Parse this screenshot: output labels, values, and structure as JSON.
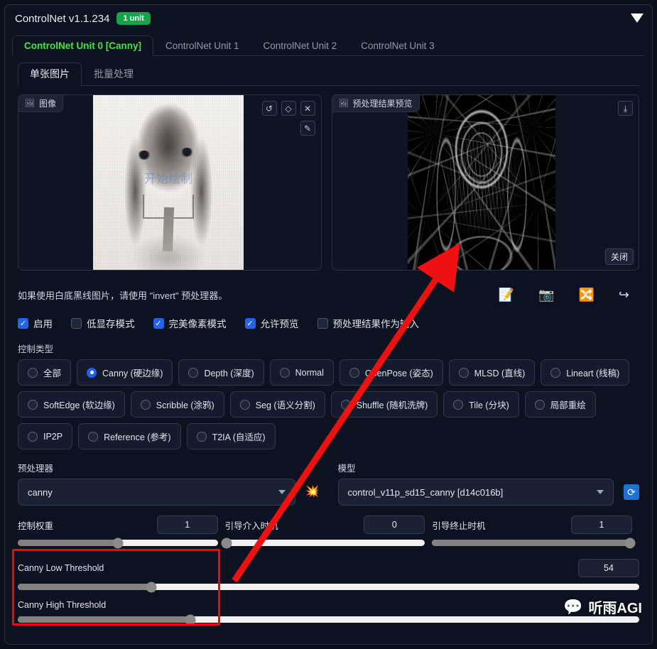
{
  "header": {
    "title": "ControlNet v1.1.234",
    "unit_badge": "1 unit",
    "collapse_icon": "chevron-down-icon"
  },
  "unit_tabs": [
    {
      "label": "ControlNet Unit 0 [Canny]",
      "active": true
    },
    {
      "label": "ControlNet Unit 1",
      "active": false
    },
    {
      "label": "ControlNet Unit 2",
      "active": false
    },
    {
      "label": "ControlNet Unit 3",
      "active": false
    }
  ],
  "sub_tabs": [
    {
      "label": "单张图片",
      "active": true
    },
    {
      "label": "批量处理",
      "active": false
    }
  ],
  "image_panel": {
    "tag": "图像",
    "tag_icon": "image-icon",
    "watermark": "开始绘制",
    "tools": {
      "undo": "↺",
      "eraser": "◇",
      "close": "✕",
      "brush": "✎"
    }
  },
  "preview_panel": {
    "tag": "预处理结果预览",
    "tag_icon": "image-icon",
    "download_icon": "⤓",
    "close_label": "关闭"
  },
  "hint": "如果使用白底黑线图片，请使用 \"invert\" 预处理器。",
  "action_icons": [
    {
      "name": "edit-note-icon",
      "glyph": "📝"
    },
    {
      "name": "camera-icon",
      "glyph": "📷"
    },
    {
      "name": "swap-arrows-icon",
      "glyph": "🔀"
    },
    {
      "name": "send-arrow-icon",
      "glyph": "↪"
    }
  ],
  "checkboxes": [
    {
      "label": "启用",
      "checked": true
    },
    {
      "label": "低显存模式",
      "checked": false
    },
    {
      "label": "完美像素模式",
      "checked": true
    },
    {
      "label": "允许预览",
      "checked": true
    },
    {
      "label": "预处理结果作为输入",
      "checked": false
    }
  ],
  "control_type": {
    "label": "控制类型",
    "options": [
      {
        "label": "全部",
        "selected": false
      },
      {
        "label": "Canny (硬边缘)",
        "selected": true
      },
      {
        "label": "Depth (深度)",
        "selected": false
      },
      {
        "label": "Normal",
        "selected": false
      },
      {
        "label": "OpenPose (姿态)",
        "selected": false
      },
      {
        "label": "MLSD (直线)",
        "selected": false
      },
      {
        "label": "Lineart (线稿)",
        "selected": false
      },
      {
        "label": "SoftEdge (软边缘)",
        "selected": false
      },
      {
        "label": "Scribble (涂鸦)",
        "selected": false
      },
      {
        "label": "Seg (语义分割)",
        "selected": false
      },
      {
        "label": "Shuffle (随机洗牌)",
        "selected": false
      },
      {
        "label": "Tile (分块)",
        "selected": false
      },
      {
        "label": "局部重绘",
        "selected": false
      },
      {
        "label": "IP2P",
        "selected": false
      },
      {
        "label": "Reference (参考)",
        "selected": false
      },
      {
        "label": "T2IA (自适应)",
        "selected": false
      }
    ]
  },
  "preprocessor": {
    "label": "预处理器",
    "value": "canny",
    "run_icon": "💥"
  },
  "model": {
    "label": "模型",
    "value": "control_v11p_sd15_canny [d14c016b]",
    "refresh_icon": "⟳"
  },
  "sliders": [
    {
      "name": "控制权重",
      "value": "1",
      "percent": 50
    },
    {
      "name": "引导介入时机",
      "value": "0",
      "percent": 0
    },
    {
      "name": "引导终止时机",
      "value": "1",
      "percent": 100
    }
  ],
  "thresholds": [
    {
      "name": "Canny Low Threshold",
      "value": "54",
      "percent": 22
    },
    {
      "name": "Canny High Threshold",
      "value": "",
      "percent": 28
    }
  ],
  "watermark": {
    "text": "听雨AGI",
    "icon": "wechat-icon"
  },
  "colors": {
    "accent_green": "#3ee83e",
    "badge_green": "#16a34a",
    "accent_blue": "#2563eb",
    "highlight_red": "#ff0000",
    "panel_bg": "#0d1220"
  }
}
